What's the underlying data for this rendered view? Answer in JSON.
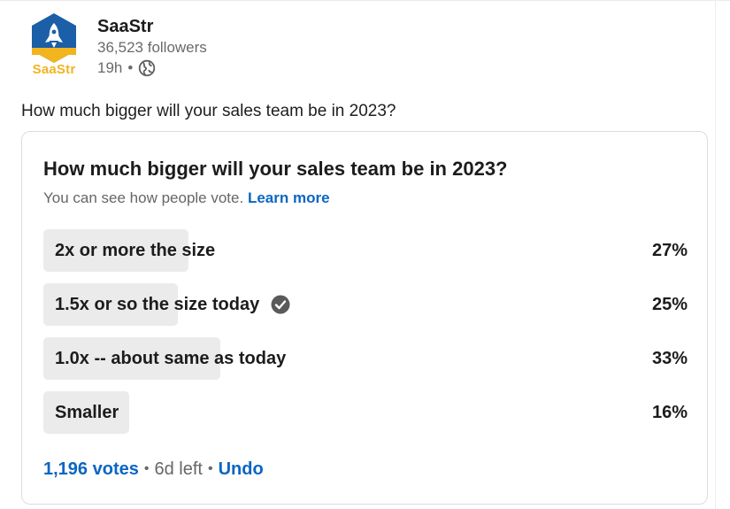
{
  "author": {
    "name": "SaaStr",
    "logo_text": "SaaStr",
    "followers": "36,523 followers",
    "time": "19h",
    "time_separator": "•",
    "visibility_icon": "globe-icon"
  },
  "post": {
    "text": "How much bigger will your sales team be in 2023?"
  },
  "poll": {
    "question": "How much bigger will your sales team be in 2023?",
    "subtitle": "You can see how people vote.",
    "learn_more": "Learn more",
    "options": [
      {
        "label": "2x or more the size",
        "percent_text": "27%",
        "percent": 27,
        "selected": false
      },
      {
        "label": "1.5x or so the size today",
        "percent_text": "25%",
        "percent": 25,
        "selected": true
      },
      {
        "label": "1.0x -- about same as today",
        "percent_text": "33%",
        "percent": 33,
        "selected": false
      },
      {
        "label": "Smaller",
        "percent_text": "16%",
        "percent": 16,
        "selected": false
      }
    ],
    "votes": "1,196 votes",
    "separator": "•",
    "time_left": "6d left",
    "undo": "Undo"
  },
  "colors": {
    "link": "#0a66c2",
    "bar": "#ebebeb",
    "logo_blue": "#1a5fa8",
    "logo_yellow": "#f2b41f"
  }
}
